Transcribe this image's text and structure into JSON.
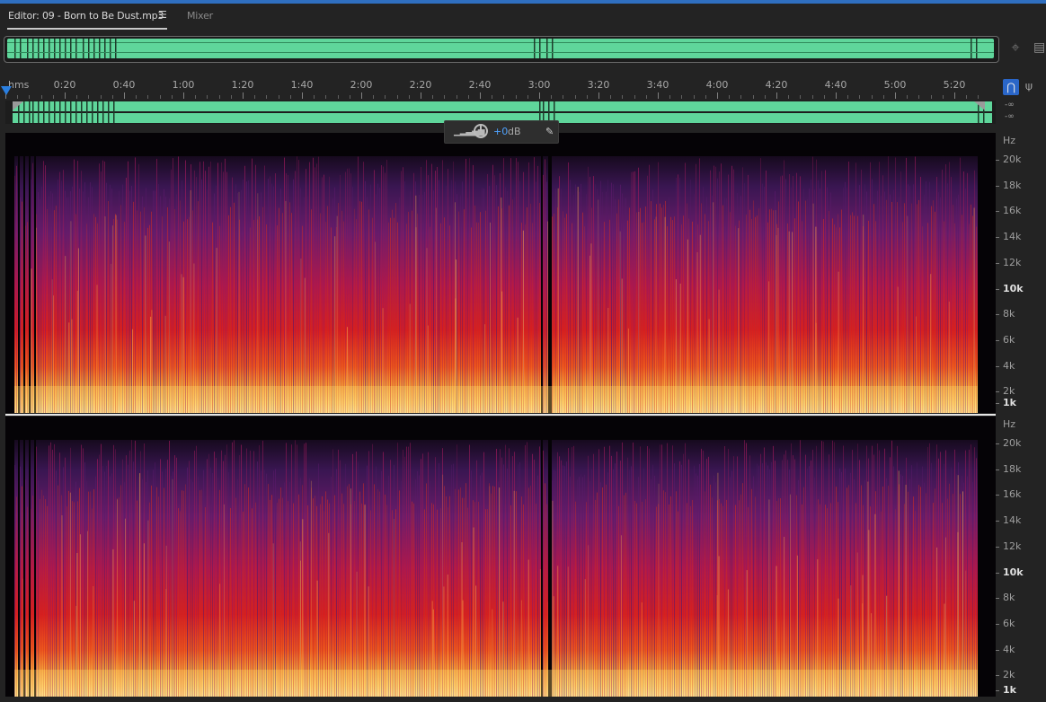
{
  "tabs": {
    "editor_label": "Editor: 09 - Born to Be Dust.mp3",
    "menu_glyph": "☰",
    "mixer_label": "Mixer"
  },
  "overview": {
    "zoom_icon": "zoom-to-selection-icon",
    "panel_icon": "panel-menu-icon"
  },
  "ruler": {
    "unit_label": "hms",
    "ticks": [
      "0:20",
      "0:40",
      "1:00",
      "1:20",
      "1:40",
      "2:00",
      "2:20",
      "2:40",
      "3:00",
      "3:20",
      "3:40",
      "4:00",
      "4:20",
      "4:40",
      "5:00",
      "5:20"
    ]
  },
  "toolbar_right": {
    "snap_icon": "snap-magnet-icon",
    "marker_icon": "marker-icon"
  },
  "meter": {
    "top_value": "-∞",
    "bottom_value": "-∞"
  },
  "volume_hud": {
    "value": "+0",
    "unit": "dB"
  },
  "freq_axis": {
    "unit": "Hz",
    "labels": [
      {
        "text": "20k",
        "bold": false
      },
      {
        "text": "18k",
        "bold": false
      },
      {
        "text": "16k",
        "bold": false
      },
      {
        "text": "14k",
        "bold": false
      },
      {
        "text": "12k",
        "bold": false
      },
      {
        "text": "10k",
        "bold": true
      },
      {
        "text": "8k",
        "bold": false
      },
      {
        "text": "6k",
        "bold": false
      },
      {
        "text": "4k",
        "bold": false
      },
      {
        "text": "2k",
        "bold": false
      },
      {
        "text": "1k",
        "bold": true
      }
    ]
  },
  "colors": {
    "accent": "#2a7fe0",
    "waveform": "#5fd69b",
    "spectral_low": "#ffd36a",
    "spectral_mid": "#d01a1a",
    "spectral_high": "#4a1a6a"
  }
}
